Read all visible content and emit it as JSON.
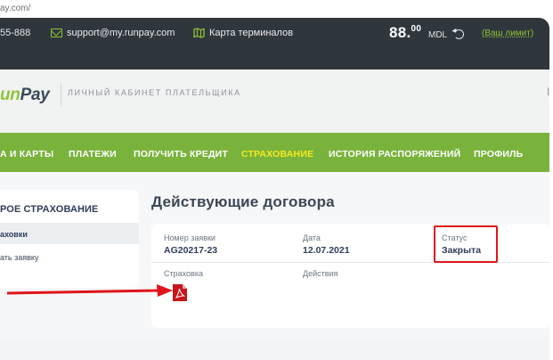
{
  "browser": {
    "url_fragment": "ay.com/"
  },
  "topbar": {
    "phone": "55-888",
    "email": "support@my.runpay.com",
    "terminals_map": "Карта терминалов",
    "balance_integer": "88.",
    "balance_decimal": "00",
    "currency": "MDL",
    "limit_link": "(Ваш лимит)",
    "icons": [
      "mail-icon",
      "map-icon",
      "refresh-icon"
    ]
  },
  "header": {
    "logo_part_green": "un",
    "logo_part_dark": "Pay",
    "cabinet_label": "ЛИЧНЫЙ КАБИНЕТ ПЛАТЕЛЬЩИКА",
    "edge_mark": "I"
  },
  "nav": {
    "items": [
      {
        "label": "А И КАРТЫ",
        "active": false
      },
      {
        "label": "ПЛАТЕЖИ",
        "active": false
      },
      {
        "label": "ПОЛУЧИТЬ КРЕДИТ",
        "active": false
      },
      {
        "label": "СТРАХОВАНИЕ",
        "active": true
      },
      {
        "label": "ИСТОРИЯ РАСПОРЯЖЕНИЙ",
        "active": false
      },
      {
        "label": "ПРОФИЛЬ",
        "active": false
      }
    ]
  },
  "sidebar": {
    "title": "РОЕ СТРАХОВАНИЕ",
    "items": [
      {
        "label": "аховки",
        "active": true
      },
      {
        "label": "ать заявку",
        "active": false
      }
    ]
  },
  "main": {
    "title": "Действующие договора",
    "contract": {
      "request_label": "Номер заявки",
      "request_value": "AG20217-23",
      "date_label": "Дата",
      "date_value": "12.07.2021",
      "status_label": "Статус",
      "status_value": "Закрыта",
      "insurance_label": "Страховка",
      "actions_label": "Действия"
    }
  },
  "colors": {
    "topbar": "#2f363c",
    "nav_green": "#7ab33c",
    "nav_active": "#f4ea1f",
    "accent_green": "#8fc43a",
    "annotation_red": "#e0151b",
    "title_dark": "#3b4656"
  }
}
